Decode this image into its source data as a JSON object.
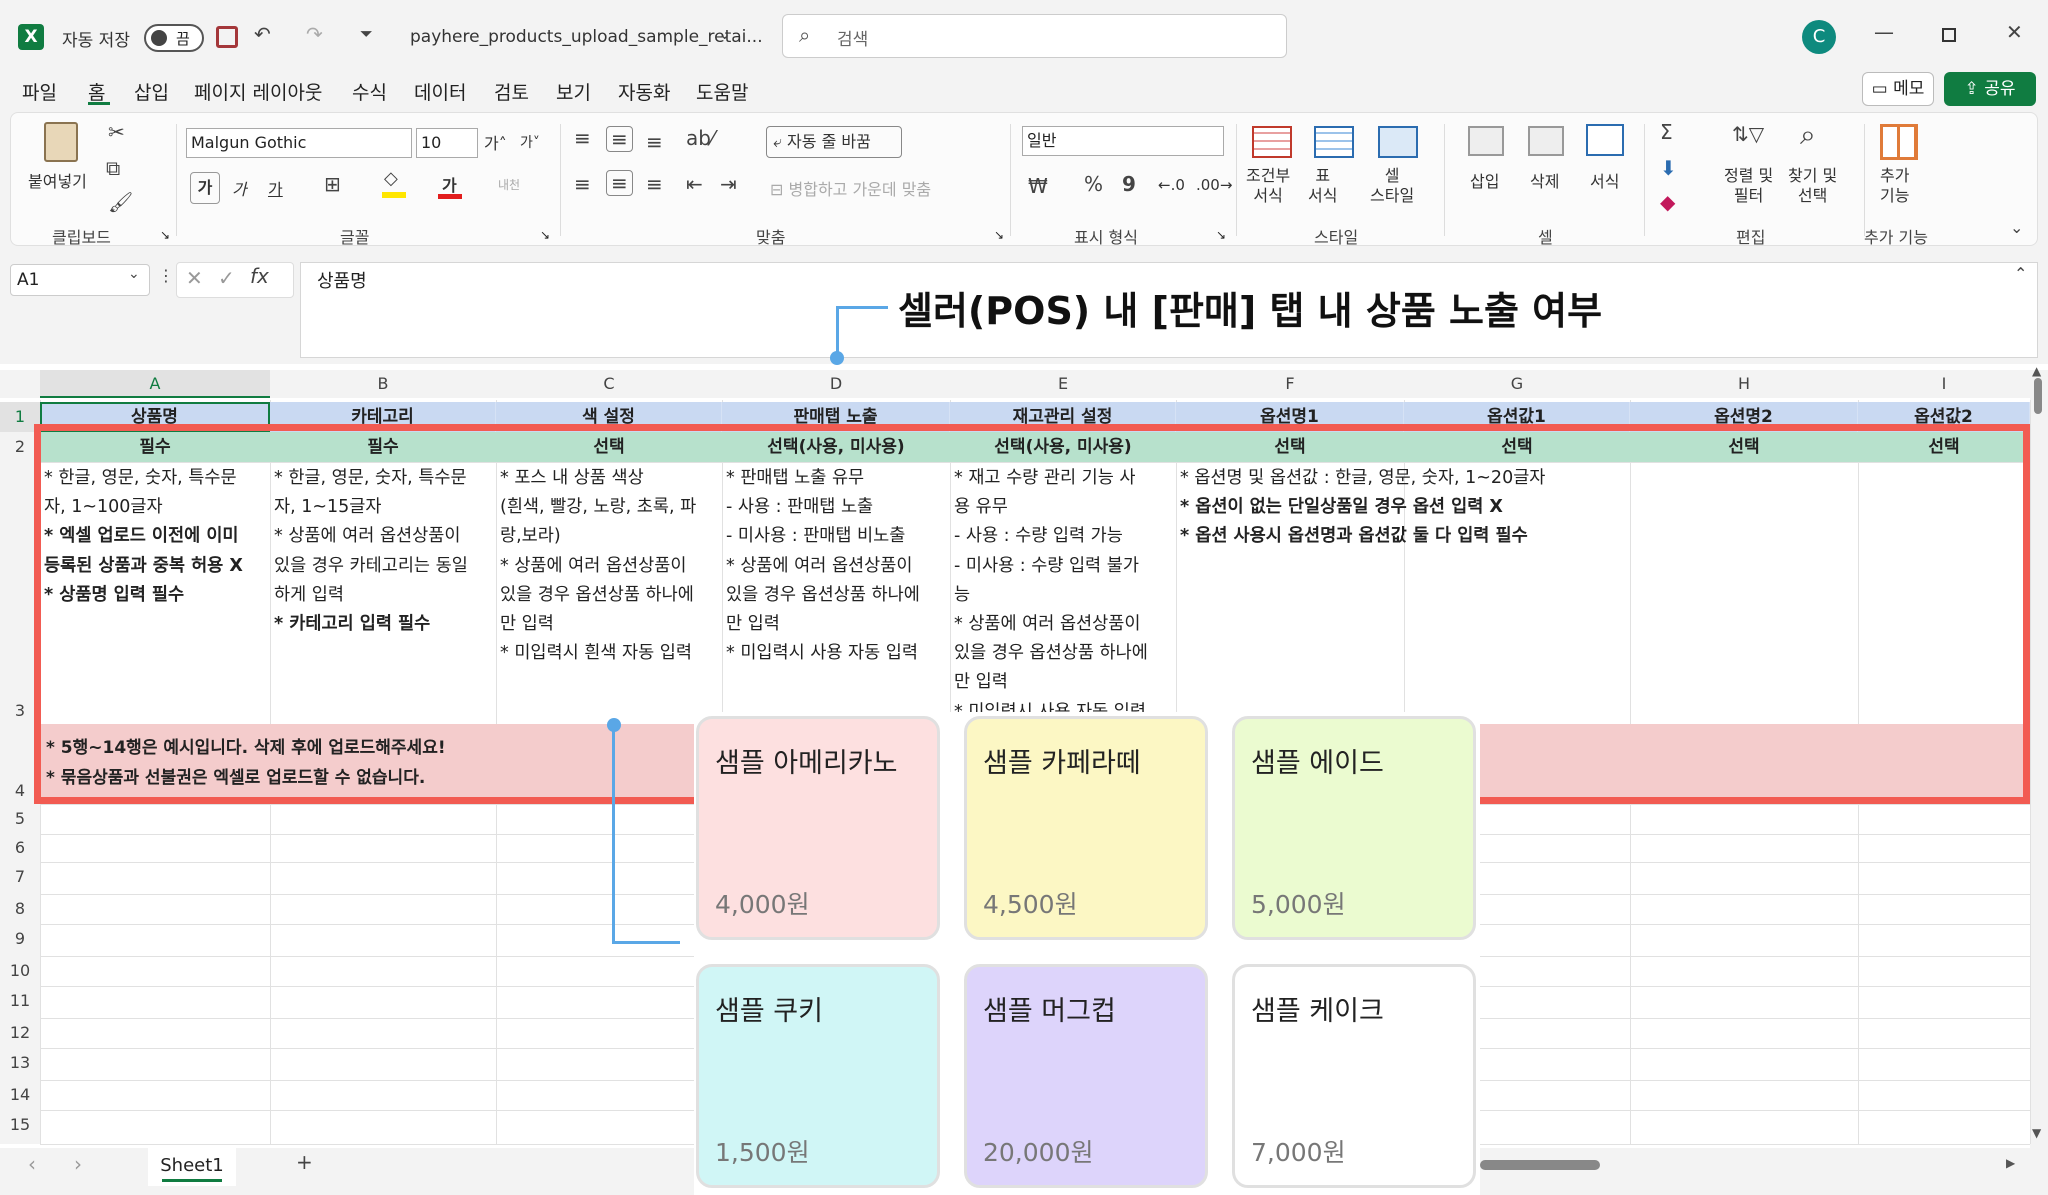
{
  "titlebar": {
    "app_icon": "excel-icon",
    "autosave_label": "자동 저장",
    "autosave_state": "끔",
    "filename": "payhere_products_upload_sample_retai...",
    "search_placeholder": "검색",
    "avatar_letter": "C"
  },
  "menu": {
    "items": [
      "파일",
      "홈",
      "삽입",
      "페이지 레이아웃",
      "수식",
      "데이터",
      "검토",
      "보기",
      "자동화",
      "도움말"
    ],
    "active": "홈",
    "memo_label": "메모",
    "share_label": "공유"
  },
  "ribbon": {
    "clipboard": {
      "paste_label": "붙여넣기",
      "group_label": "클립보드"
    },
    "font": {
      "font_name": "Malgun Gothic",
      "font_size": "10",
      "group_label": "글꼴",
      "bold": "가",
      "italic": "가",
      "underline": "가",
      "strike": "가",
      "phonetic": "내천"
    },
    "alignment": {
      "wrap_label": "자동 줄 바꿈",
      "merge_label": "병합하고 가운데 맞춤",
      "group_label": "맞춤"
    },
    "number": {
      "format": "일반",
      "percent": "%",
      "comma": "9",
      "group_label": "표시 형식"
    },
    "styles": {
      "cond_label": "조건부\n서식",
      "table_label": "표\n서식",
      "cell_label": "셀\n스타일",
      "group_label": "스타일"
    },
    "cells": {
      "insert_label": "삽입",
      "delete_label": "삭제",
      "format_label": "서식",
      "group_label": "셀"
    },
    "editing": {
      "sort_label": "정렬 및\n필터",
      "find_label": "찾기 및\n선택",
      "group_label": "편집"
    },
    "addins": {
      "label": "추가\n기능",
      "group_label": "추가 기능"
    }
  },
  "formula_bar": {
    "name_box": "A1",
    "fx": "fx",
    "content": "상품명"
  },
  "callout": {
    "text": "셀러(POS) 내 [판매] 탭 내 상품 노출 여부"
  },
  "columns": [
    "A",
    "B",
    "C",
    "D",
    "E",
    "F",
    "G",
    "H",
    "I"
  ],
  "rows": [
    "1",
    "2",
    "3",
    "4",
    "5",
    "6",
    "7",
    "8",
    "9",
    "10",
    "11",
    "12",
    "13",
    "14",
    "15"
  ],
  "row1": [
    "상품명",
    "카테고리",
    "색 설정",
    "판매탭 노출",
    "재고관리 설정",
    "옵션명1",
    "옵션값1",
    "옵션명2",
    "옵션값2"
  ],
  "row2": [
    "필수",
    "필수",
    "선택",
    "선택(사용, 미사용)",
    "선택(사용, 미사용)",
    "선택",
    "선택",
    "선택",
    "선택"
  ],
  "row3": {
    "A": [
      {
        "t": "* 한글, 영문, 숫자, 특수문",
        "b": false
      },
      {
        "t": "자, 1~100글자",
        "b": false
      },
      {
        "t": "* 엑셀 업로드 이전에 이미",
        "b": true
      },
      {
        "t": "등록된 상품과 중복 허용 X",
        "b": true
      },
      {
        "t": "* 상품명 입력 필수",
        "b": true
      }
    ],
    "B": [
      {
        "t": "* 한글, 영문, 숫자, 특수문",
        "b": false
      },
      {
        "t": "자, 1~15글자",
        "b": false
      },
      {
        "t": "* 상품에 여러 옵션상품이",
        "b": false
      },
      {
        "t": "있을 경우 카테고리는 동일",
        "b": false
      },
      {
        "t": "하게 입력",
        "b": false
      },
      {
        "t": "* 카테고리 입력 필수",
        "b": true
      }
    ],
    "C": [
      {
        "t": "* 포스 내 상품 색상",
        "b": false
      },
      {
        "t": "(흰색, 빨강, 노랑, 초록, 파",
        "b": false
      },
      {
        "t": "랑,보라)",
        "b": false
      },
      {
        "t": "* 상품에 여러 옵션상품이",
        "b": false
      },
      {
        "t": "있을 경우 옵션상품 하나에",
        "b": false
      },
      {
        "t": "만 입력",
        "b": false
      },
      {
        "t": "* 미입력시 흰색 자동 입력",
        "b": false
      }
    ],
    "D": [
      {
        "t": "* 판매탭 노출 유무",
        "b": false
      },
      {
        "t": "- 사용 : 판매탭 노출",
        "b": false
      },
      {
        "t": "- 미사용 : 판매탭 비노출",
        "b": false
      },
      {
        "t": "* 상품에 여러 옵션상품이",
        "b": false
      },
      {
        "t": "있을 경우 옵션상품 하나에",
        "b": false
      },
      {
        "t": "만 입력",
        "b": false
      },
      {
        "t": "* 미입력시 사용 자동 입력",
        "b": false
      }
    ],
    "E": [
      {
        "t": "* 재고 수량 관리 기능 사",
        "b": false
      },
      {
        "t": "용 유무",
        "b": false
      },
      {
        "t": "- 사용 : 수량 입력 가능",
        "b": false
      },
      {
        "t": "- 미사용 : 수량 입력 불가",
        "b": false
      },
      {
        "t": "능",
        "b": false
      },
      {
        "t": "* 상품에 여러 옵션상품이",
        "b": false
      },
      {
        "t": "있을 경우 옵션상품 하나에",
        "b": false
      },
      {
        "t": "만 입력",
        "b": false
      },
      {
        "t": "* 미입력시 사용 자동 입력",
        "b": false
      }
    ],
    "F": [
      {
        "t": "* 옵션명 및 옵션값 : 한글, 영문, 숫자, 1~20글자",
        "b": false
      },
      {
        "t": "* 옵션이 없는 단일상품일 경우 옵션 입력 X",
        "b": true
      },
      {
        "t": "* 옵션 사용시 옵션명과 옵션값 둘 다 입력 필수",
        "b": true
      }
    ]
  },
  "row4": [
    "* 5행~14행은 예시입니다. 삭제 후에 업로드해주세요!",
    "* 묶음상품과 선불권은 엑셀로 업로드할 수 없습니다."
  ],
  "products": [
    {
      "name": "샘플 아메리카노",
      "price": "4,000원",
      "color": "#fde0e0"
    },
    {
      "name": "샘플 카페라떼",
      "price": "4,500원",
      "color": "#fcf7c4"
    },
    {
      "name": "샘플 에이드",
      "price": "5,000원",
      "color": "#ebfbd0"
    },
    {
      "name": "샘플 쿠키",
      "price": "1,500원",
      "color": "#d0f6f6"
    },
    {
      "name": "샘플 머그컵",
      "price": "20,000원",
      "color": "#ddd4fb"
    },
    {
      "name": "샘플 케이크",
      "price": "7,000원",
      "color": "#ffffff"
    }
  ],
  "sheet": {
    "tab": "Sheet1",
    "add": "+"
  },
  "colors": {
    "excel_green": "#107c41",
    "highlight_red": "#f25b52",
    "callout_blue": "#5aa7e6",
    "header_blue": "#c9d9f2",
    "header_green": "#b7e1cc",
    "note_pink": "#f4cccc"
  }
}
